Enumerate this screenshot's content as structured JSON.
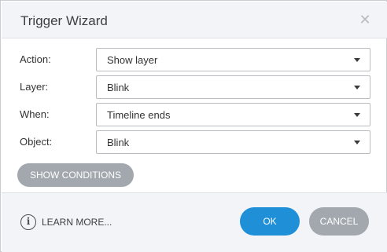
{
  "dialog": {
    "title": "Trigger Wizard",
    "close_icon": "close-icon"
  },
  "fields": [
    {
      "label": "Action:",
      "value": "Show layer"
    },
    {
      "label": "Layer:",
      "value": "Blink"
    },
    {
      "label": "When:",
      "value": "Timeline ends"
    },
    {
      "label": "Object:",
      "value": "Blink"
    }
  ],
  "buttons": {
    "show_conditions": "SHOW CONDITIONS",
    "ok": "OK",
    "cancel": "CANCEL"
  },
  "footer": {
    "learn_more": "LEARN MORE...",
    "info_icon_glyph": "i"
  },
  "colors": {
    "accent": "#1f8fd8",
    "secondary_button": "#a2a8ae",
    "panel_background": "#f2f4f7"
  }
}
